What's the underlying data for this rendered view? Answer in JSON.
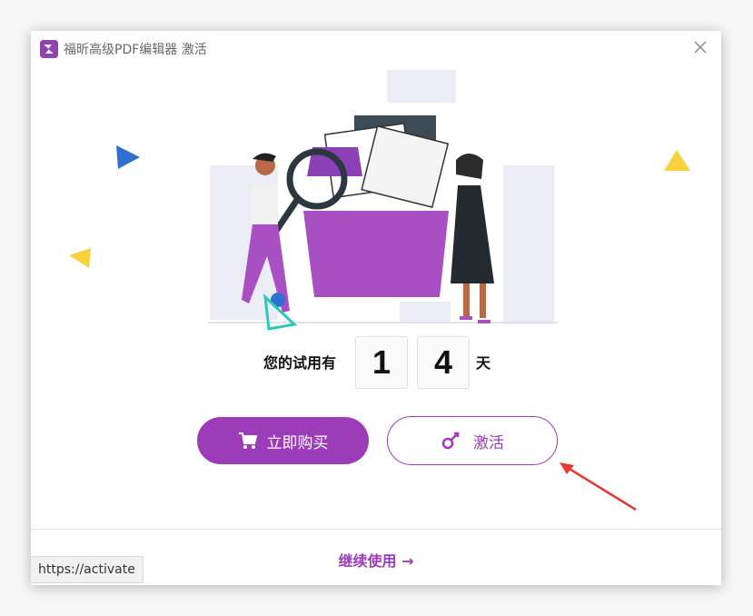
{
  "window": {
    "title": "福昕高级PDF编辑器 激活",
    "close_icon": "close-icon"
  },
  "trial": {
    "label": "您的试用有",
    "digit1": "1",
    "digit2": "4",
    "unit": "天"
  },
  "buttons": {
    "buy_label": "立即购买",
    "buy_icon": "cart-icon",
    "activate_label": "激活",
    "activate_icon": "key-icon"
  },
  "footer": {
    "continue_label": "继续使用 →"
  },
  "statusbar": {
    "url": "https://activate"
  },
  "colors": {
    "accent": "#9c3cb9",
    "arrow": "#e53935",
    "triangle_blue": "#2f6fd0",
    "triangle_yellow": "#f7d23c"
  }
}
